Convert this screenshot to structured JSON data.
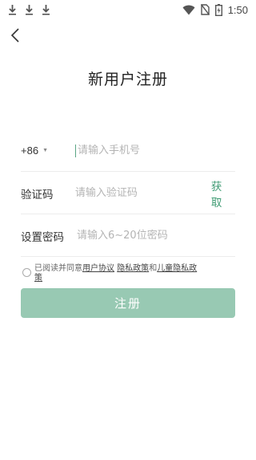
{
  "status_bar": {
    "time": "1:50",
    "left_icons": [
      "download-icon",
      "download-icon",
      "download-icon"
    ],
    "right_icons": [
      "wifi-icon",
      "no-sim-icon",
      "battery-charging-icon"
    ]
  },
  "header": {
    "back_icon": "chevron-left-icon",
    "title": "新用户注册"
  },
  "form": {
    "phone": {
      "country_code": "+86",
      "placeholder": "请输入手机号"
    },
    "code": {
      "label": "验证码",
      "placeholder": "请输入验证码",
      "action": "获取"
    },
    "password": {
      "label": "设置密码",
      "placeholder": "请输入6~20位密码"
    }
  },
  "agreement": {
    "prefix": "已阅读并同意",
    "link_user": "用户协议",
    "link_privacy": "隐私政策",
    "conj": "和",
    "link_child": "儿童隐私政策"
  },
  "submit_label": "注册",
  "colors": {
    "accent": "#3d9a72",
    "button_disabled": "#98c9b3"
  }
}
